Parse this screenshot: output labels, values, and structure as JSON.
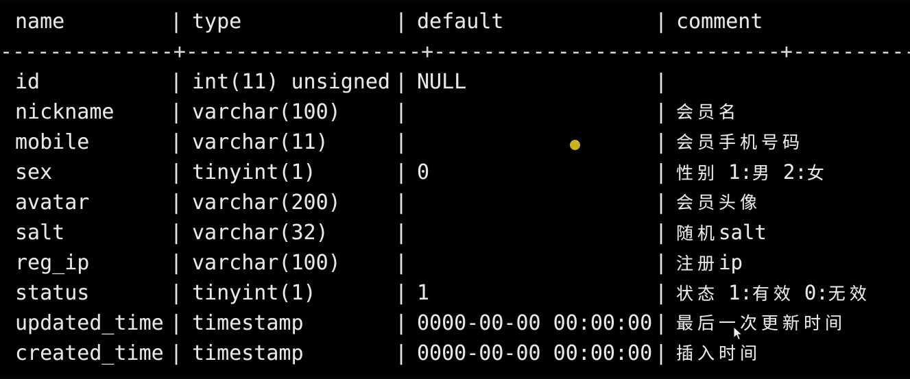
{
  "terminal": {
    "background_color": "#000000",
    "foreground_color": "#e8e8e8",
    "dot_color": "#c8b420",
    "header": {
      "name": "name",
      "type": "type",
      "default": "default",
      "comment": "comment"
    },
    "separator": "|",
    "rule": "--------------+-------------------+----------------------------+------------------------------",
    "rows": [
      {
        "name": "id",
        "type": "int(11) unsigned",
        "default": "NULL",
        "comment": ""
      },
      {
        "name": "nickname",
        "type": "varchar(100)",
        "default": "",
        "comment": "会员名"
      },
      {
        "name": "mobile",
        "type": "varchar(11)",
        "default": "",
        "comment": "会员手机号码"
      },
      {
        "name": "sex",
        "type": "tinyint(1)",
        "default": "0",
        "comment": "性别 1:男 2:女"
      },
      {
        "name": "avatar",
        "type": "varchar(200)",
        "default": "",
        "comment": "会员头像"
      },
      {
        "name": "salt",
        "type": "varchar(32)",
        "default": "",
        "comment": "随机salt"
      },
      {
        "name": "reg_ip",
        "type": "varchar(100)",
        "default": "",
        "comment": "注册ip"
      },
      {
        "name": "status",
        "type": "tinyint(1)",
        "default": "1",
        "comment": "状态 1:有效 0:无效"
      },
      {
        "name": "updated_time",
        "type": "timestamp",
        "default": "0000-00-00 00:00:00",
        "comment": "最后一次更新时间"
      },
      {
        "name": "created_time",
        "type": "timestamp",
        "default": "0000-00-00 00:00:00",
        "comment": "插入时间"
      }
    ]
  }
}
